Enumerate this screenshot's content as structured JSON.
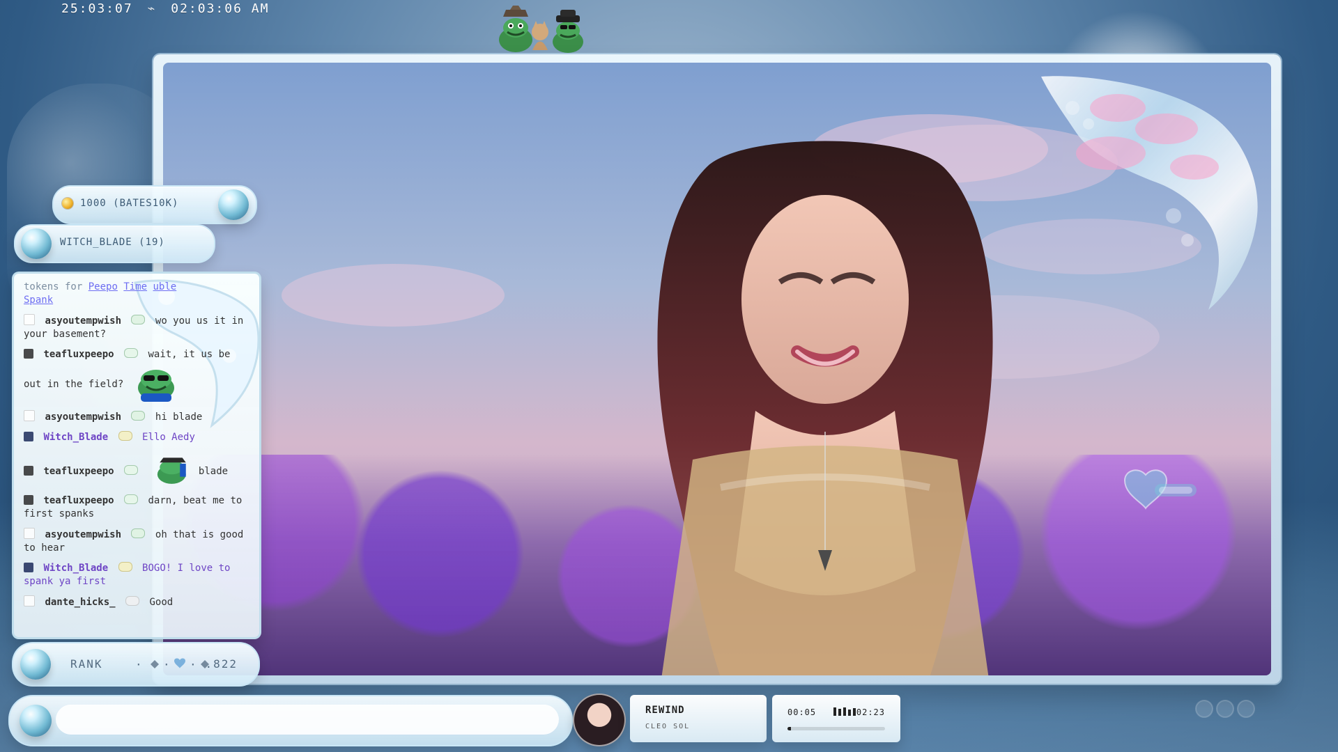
{
  "top_bar": {
    "clock_left": "25:03:07",
    "clock_right": "02:03:06 AM"
  },
  "pills": {
    "tokens": "1000 (BATES10K)",
    "leader": "WITCH_BLADE (19)"
  },
  "chat": {
    "header_prefix": "tokens for",
    "header_link_1": "Peepo",
    "header_link_2": "Time",
    "header_link_3": "uble",
    "header_link_4": "Spank",
    "lines": [
      {
        "user": "asyoutempwish",
        "text": "wo you us it in your basement?",
        "user_color": "normal"
      },
      {
        "user": "teafluxpeepo",
        "text": "wait, it us be",
        "user_color": "normal"
      },
      {
        "user": "",
        "text": "out in the field?",
        "user_color": "normal"
      },
      {
        "user": "asyoutempwish",
        "text": "hi blade",
        "user_color": "normal"
      },
      {
        "user": "Witch_Blade",
        "text": "Ello Aedy",
        "user_color": "purple"
      },
      {
        "user": "teafluxpeepo",
        "text": "blade",
        "user_color": "normal"
      },
      {
        "user": "teafluxpeepo",
        "text": "darn, beat me to first spanks",
        "user_color": "normal"
      },
      {
        "user": "asyoutempwish",
        "text": "oh that is good to hear",
        "user_color": "normal"
      },
      {
        "user": "Witch_Blade",
        "text": "BOGO! I love to spank ya first",
        "user_color": "purple"
      },
      {
        "user": "dante_hicks_",
        "text": "Good",
        "user_color": "normal"
      }
    ]
  },
  "rank": {
    "label": "RANK",
    "value": ".822"
  },
  "music": {
    "title": "REWIND",
    "artist": "CLEO SOL",
    "time_left": "00:05",
    "time_right": "02:23",
    "progress": 0.035
  },
  "colors": {
    "accent_purple": "#6e45c5",
    "chat_link": "#6d6df2"
  },
  "icons": {
    "gem": "gem-icon",
    "coin": "coin-icon",
    "heart": "heart-icon"
  }
}
